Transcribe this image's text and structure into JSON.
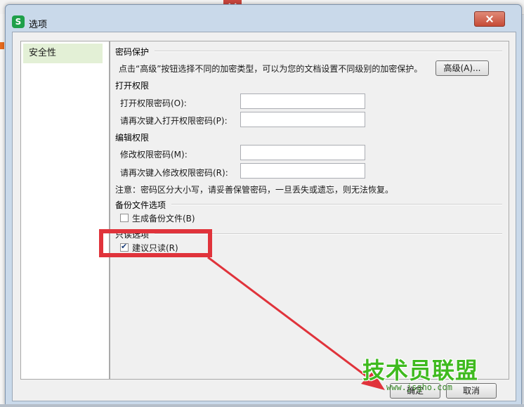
{
  "dialog": {
    "icon_letter": "S",
    "title": "选项"
  },
  "sidebar": {
    "items": [
      {
        "label": "安全性",
        "selected": true
      }
    ]
  },
  "security": {
    "password_protection": {
      "heading": "密码保护",
      "description": "点击“高级”按钮选择不同的加密类型，可以为您的文档设置不同级别的加密保护。",
      "advanced_button": "高级(A)..."
    },
    "open_permission": {
      "heading": "打开权限",
      "password_label": "打开权限密码(O):",
      "password_value": "",
      "confirm_label": "请再次键入打开权限密码(P):",
      "confirm_value": ""
    },
    "edit_permission": {
      "heading": "编辑权限",
      "password_label": "修改权限密码(M):",
      "password_value": "",
      "confirm_label": "请再次键入修改权限密码(R):",
      "confirm_value": ""
    },
    "note": "注意：密码区分大小写，请妥善保管密码，一旦丢失或遗忘，则无法恢复。",
    "backup": {
      "heading": "备份文件选项",
      "checkbox_label": "生成备份文件(B)",
      "checked": false
    },
    "readonly": {
      "heading": "只读选项",
      "checkbox_label": "建议只读(R)",
      "checked": true
    }
  },
  "buttons": {
    "ok": "确定",
    "cancel": "取消"
  },
  "watermark": {
    "main": "技术员联盟",
    "url": "www.jsgho.com"
  },
  "colors": {
    "highlight": "#e0333b",
    "selected_nav": "#e3f0d6",
    "watermark": "#3fba1f"
  }
}
